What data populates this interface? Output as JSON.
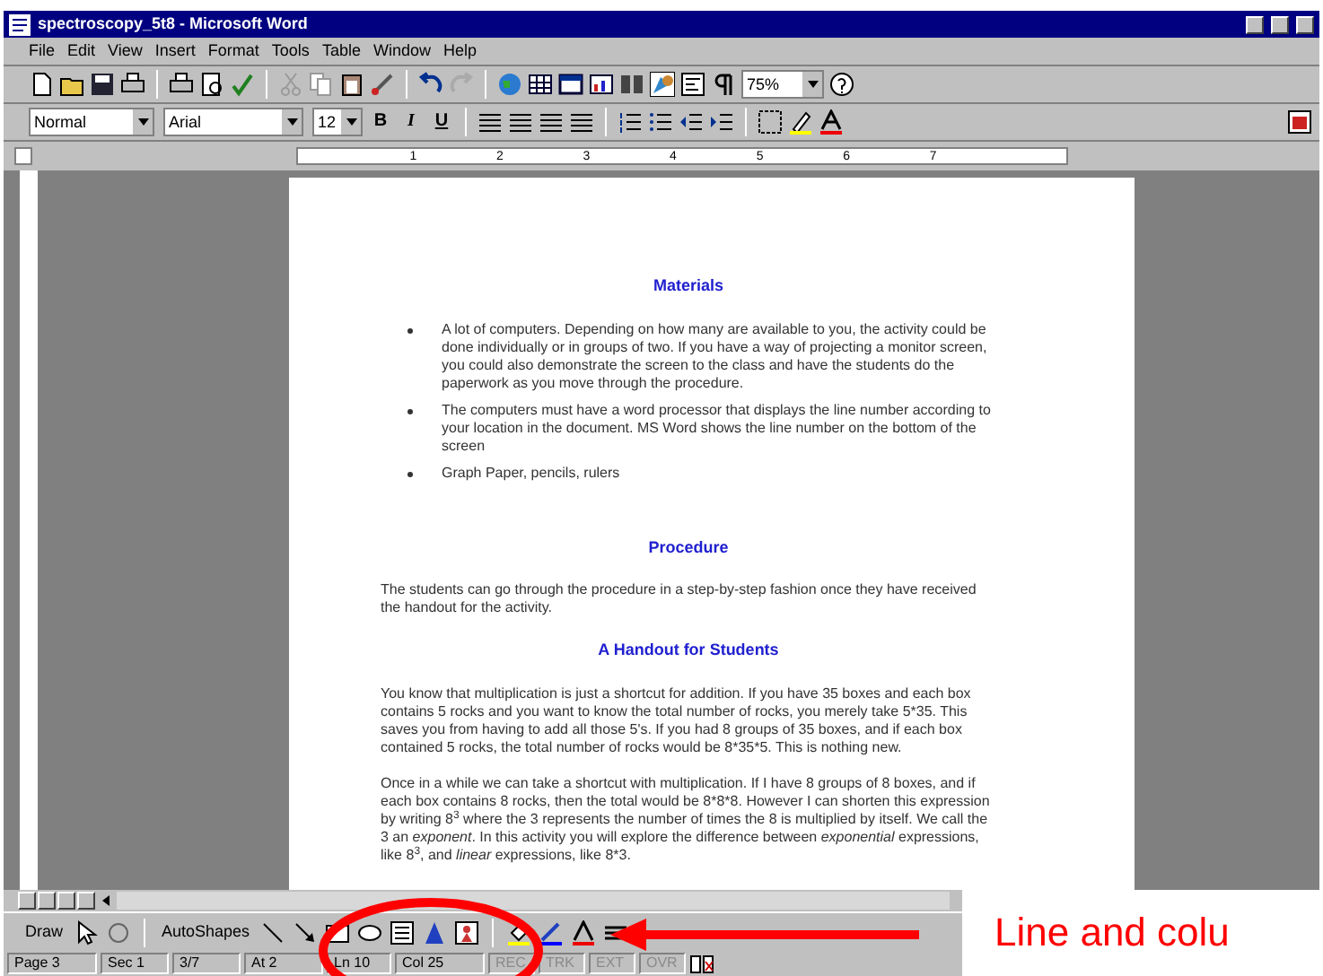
{
  "window": {
    "title": "spectroscopy_5t8 - Microsoft Word"
  },
  "menu": [
    "File",
    "Edit",
    "View",
    "Insert",
    "Format",
    "Tools",
    "Table",
    "Window",
    "Help"
  ],
  "standard": {
    "zoom": "75%"
  },
  "formatting": {
    "style": "Normal",
    "font": "Arial",
    "size": "12",
    "bold": "B",
    "italic": "I",
    "underline": "U"
  },
  "ruler": [
    "1",
    "2",
    "3",
    "4",
    "5",
    "6",
    "7"
  ],
  "document": [
    {
      "kind": "heading",
      "text": "Materials"
    },
    {
      "kind": "bullets",
      "items": [
        "A lot of computers.  Depending on how many are available to you, the activity could be done individually or in groups of two.  If you have a way of projecting a monitor screen, you could also demonstrate the screen to the class and have the students do the paperwork as you move through the procedure.",
        "The computers must have a word processor that displays the line number according to your location in the document.  MS Word shows the line number on the bottom of the screen",
        "Graph Paper, pencils, rulers"
      ]
    },
    {
      "kind": "heading",
      "text": "Procedure"
    },
    {
      "kind": "paragraph",
      "text": "The students can go through the procedure in a step-by-step fashion once they have received the handout for the activity."
    },
    {
      "kind": "heading",
      "text": "A Handout for Students"
    },
    {
      "kind": "paragraph",
      "text": "You know that multiplication is just a shortcut for addition.  If you have 35 boxes and each box contains 5 rocks and you want to know the total number of rocks, you merely take 5*35.  This saves you from having to add all those 5's.  If you had 8 groups of 35 boxes, and if each box contained 5 rocks, the total number of rocks would be 8*35*5.  This is nothing new."
    },
    {
      "kind": "paragraph",
      "text": "Once in a while we can take a shortcut with multiplication.  If I have 8 groups of 8 boxes, and if each box contains 8 rocks, then the total would be 8*8*8.  However I can shorten this expression by writing 8$^{3}$ where the 3 represents the number of times the 8 is multiplied by itself.  We call the 3 an *exponent*.  In this activity you will explore the difference between *exponential* expressions, like 8$^{3}$, and *linear* expressions, like 8*3."
    }
  ],
  "drawing_toolbar": {
    "draw": "Draw",
    "autoshapes": "AutoShapes"
  },
  "status_bar": [
    "Page 3",
    "Sec 1",
    "3/7",
    "At 2",
    "Ln 10",
    "Col 25"
  ],
  "status_modes": [
    {
      "label": "REC",
      "on": false
    },
    {
      "label": "TRK",
      "on": false
    },
    {
      "label": "EXT",
      "on": false
    },
    {
      "label": "OVR",
      "on": false
    }
  ],
  "annotation": {
    "text": "Line and colu"
  }
}
